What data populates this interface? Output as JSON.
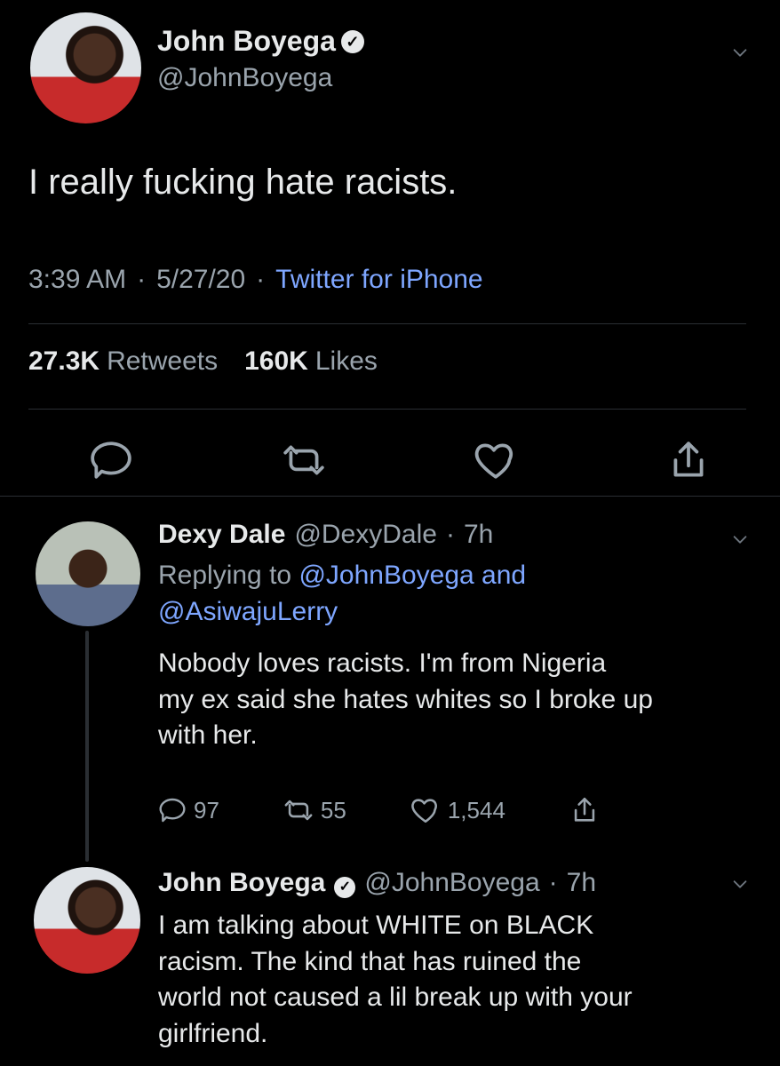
{
  "main_tweet": {
    "display_name": "John Boyega",
    "handle": "@JohnBoyega",
    "text": "I really fucking hate racists.",
    "time": "3:39 AM",
    "date": "5/27/20",
    "source": "Twitter for iPhone",
    "stats": {
      "retweets_count": "27.3K",
      "retweets_label": "Retweets",
      "likes_count": "160K",
      "likes_label": "Likes"
    }
  },
  "replies": [
    {
      "display_name": "Dexy Dale",
      "handle": "@DexyDale",
      "time_ago": "7h",
      "replying_to_prefix": "Replying to",
      "replying_to_user1": "@JohnBoyega",
      "replying_to_conj": "and",
      "replying_to_user2": "@AsiwajuLerry",
      "text_line1": "Nobody loves racists. I'm from Nigeria",
      "text_line2": "my ex said she hates whites so I broke up",
      "text_line3": "with her.",
      "counts": {
        "replies": "97",
        "retweets": "55",
        "likes": "1,544"
      }
    },
    {
      "display_name": "John Boyega",
      "handle": "@JohnBoyega",
      "time_ago": "7h",
      "text_line1": "I am talking about WHITE on BLACK",
      "text_line2": "racism. The kind that has ruined the",
      "text_line3": "world not caused a lil break up with your",
      "text_line4": "girlfriend."
    }
  ],
  "icons": {
    "verified": "verified-badge-icon",
    "chevron": "chevron-down-icon",
    "reply": "reply-icon",
    "retweet": "retweet-icon",
    "like": "heart-icon",
    "share": "share-icon"
  },
  "colors": {
    "background": "#000000",
    "text": "#e7e9ea",
    "muted": "#9aa4ad",
    "link": "#7ea6ff",
    "divider": "#2a2e33"
  },
  "glyphs": {
    "dot": "·",
    "verified_check": "✓"
  }
}
